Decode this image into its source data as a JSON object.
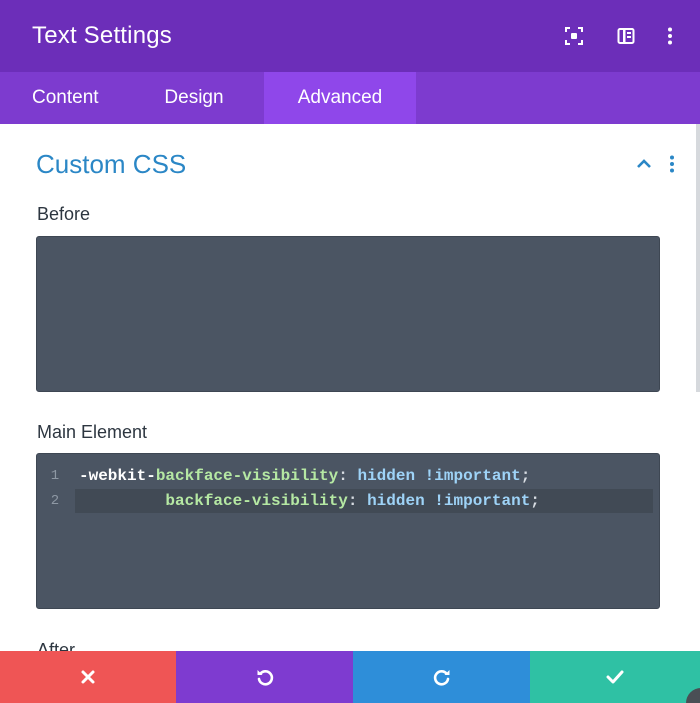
{
  "header": {
    "title": "Text Settings",
    "icons": [
      "expand-icon",
      "split-view-icon",
      "more-vertical-icon"
    ]
  },
  "tabs": [
    {
      "label": "Content",
      "active": false
    },
    {
      "label": "Design",
      "active": false
    },
    {
      "label": "Advanced",
      "active": true
    }
  ],
  "section": {
    "title": "Custom CSS",
    "collapse_icon": "chevron-up-icon",
    "menu_icon": "more-vertical-icon"
  },
  "fields": {
    "before": {
      "label": "Before",
      "value": ""
    },
    "main_element": {
      "label": "Main Element",
      "lines": [
        {
          "number": "1",
          "prefix": "-webkit-",
          "property": "backface-visibility",
          "colon": ":",
          "value": " hidden !important",
          "end": ";"
        },
        {
          "number": "2",
          "indent": "         ",
          "property": "backface-visibility",
          "colon": ":",
          "value": " hidden !important",
          "end": ";"
        }
      ]
    },
    "after": {
      "label": "After"
    }
  },
  "footer": {
    "buttons": [
      {
        "name": "cancel",
        "icon": "close-icon",
        "color": "#ef5555"
      },
      {
        "name": "undo",
        "icon": "undo-icon",
        "color": "#7e3bd0"
      },
      {
        "name": "redo",
        "icon": "redo-icon",
        "color": "#2e8ed9"
      },
      {
        "name": "save",
        "icon": "check-icon",
        "color": "#2fc1a4"
      }
    ]
  },
  "colors": {
    "header": "#6c2eb9",
    "tabs": "#7d3bcf",
    "active_tab": "#8f47ea",
    "section_title": "#2b87c6",
    "editor_bg": "#4b5563"
  }
}
